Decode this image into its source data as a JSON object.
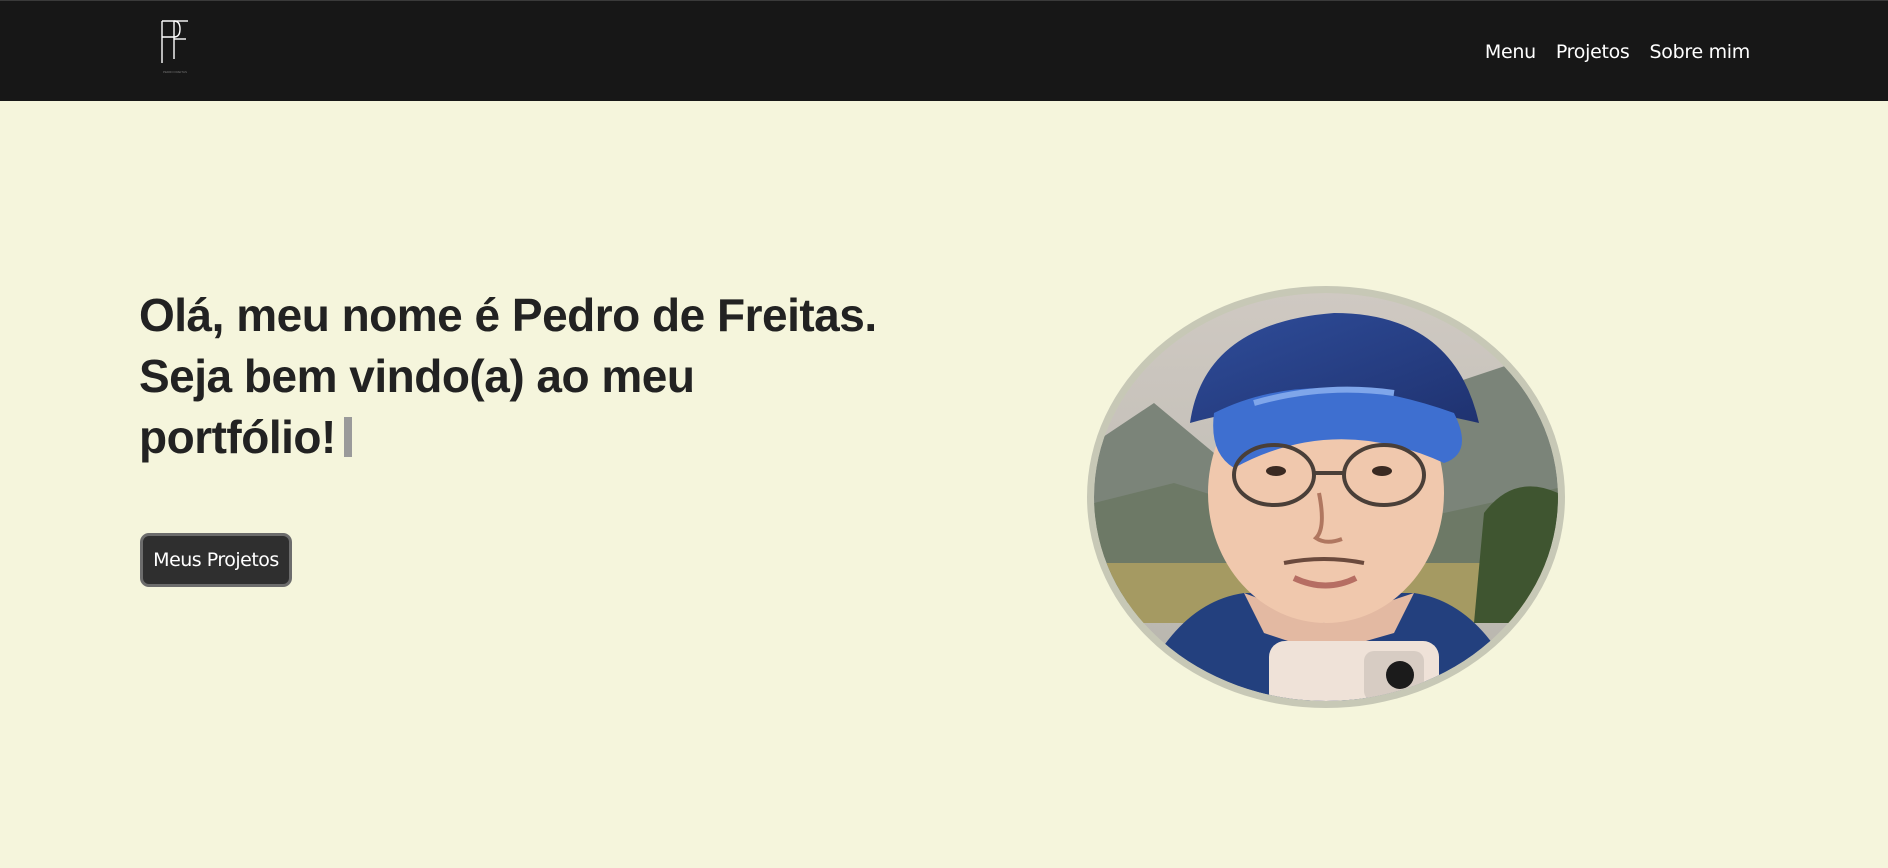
{
  "header": {
    "logo_icon": "pf-monogram-logo",
    "logo_subtext": "PEDRO FREITAS",
    "nav": [
      {
        "label": "Menu"
      },
      {
        "label": "Projetos"
      },
      {
        "label": "Sobre mim"
      }
    ]
  },
  "hero": {
    "heading_line1": "Olá, meu nome é Pedro de Freitas.",
    "heading_line2": "Seja bem vindo(a) ao meu",
    "heading_line3": "portfólio!",
    "cta_label": "Meus Projetos",
    "avatar_alt": "Pedro de Freitas illustrated portrait"
  },
  "colors": {
    "header_bg": "#171717",
    "page_bg": "#f5f5dc",
    "text": "#222222",
    "button_bg": "#2f2f2f",
    "avatar_ring": "#c7c8b6"
  }
}
